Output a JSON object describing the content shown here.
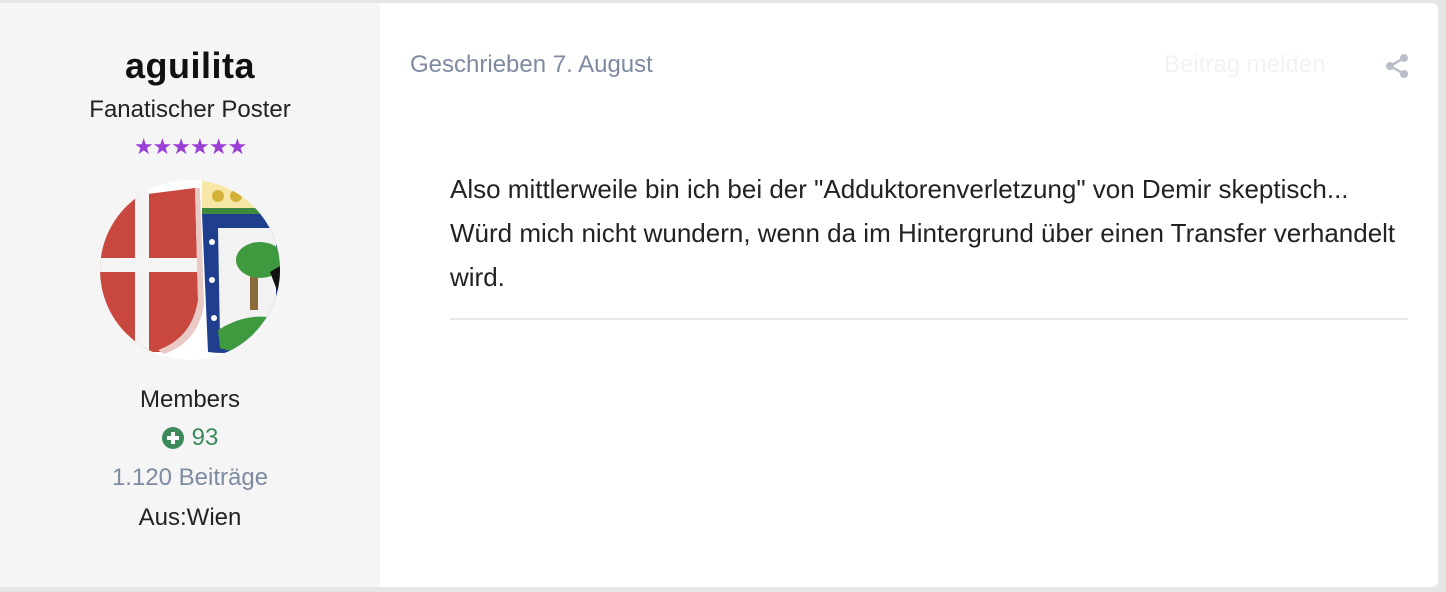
{
  "author": {
    "username": "aguilita",
    "rank_title": "Fanatischer Poster",
    "rank_stars": "★★★★★★",
    "group": "Members",
    "reputation": "93",
    "post_count": "1.120 Beiträge",
    "location": "Aus:Wien",
    "avatar_icon": "club-crest-avatar"
  },
  "post": {
    "date_label": "Geschrieben 7. August",
    "report_label": "Beitrag melden",
    "share_icon": "share-icon",
    "body": "Also mittlerweile bin ich bei der \"Adduktorenverletzung\" von Demir skeptisch... Würd mich nicht wundern, wenn da im Hintergrund über einen Transfer verhandelt wird."
  },
  "colors": {
    "reputation_green": "#3c8a5c",
    "rank_star_purple": "#9a3fd6",
    "meta_gray": "#7d8aa0",
    "sidebar_bg": "#f5f5f5"
  }
}
